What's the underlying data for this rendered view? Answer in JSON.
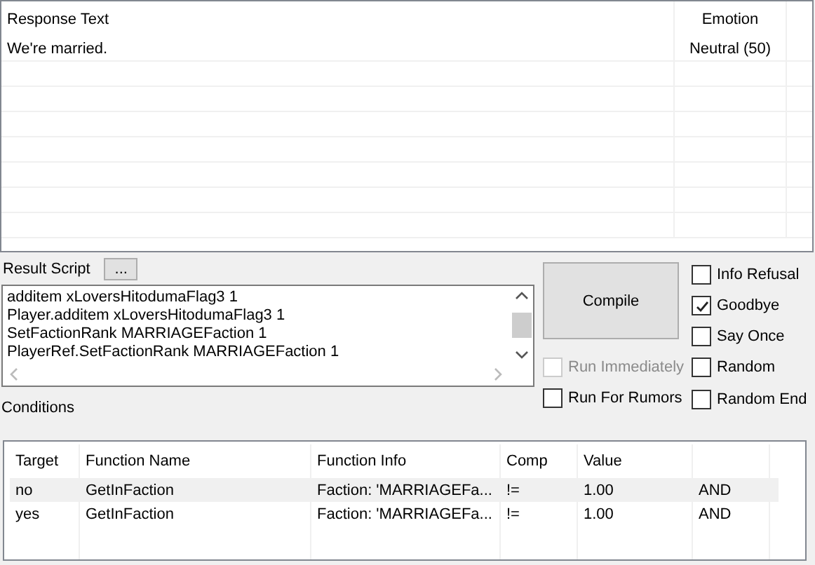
{
  "responses": {
    "columns": [
      "Response Text",
      "Emotion"
    ],
    "rows": [
      {
        "text": "We're married.",
        "emotion": "Neutral (50)"
      }
    ]
  },
  "result_script": {
    "label": "Result Script",
    "browse_button": "...",
    "lines": [
      "additem xLoversHitodumaFlag3 1",
      "Player.additem xLoversHitodumaFlag3 1",
      "SetFactionRank MARRIAGEFaction 1",
      "PlayerRef.SetFactionRank MARRIAGEFaction 1"
    ]
  },
  "compile_button": "Compile",
  "run_options": [
    {
      "label": "Run Immediately",
      "checked": false,
      "disabled": true
    },
    {
      "label": "Run For Rumors",
      "checked": false,
      "disabled": false
    }
  ],
  "flags": [
    {
      "label": "Info Refusal",
      "checked": false
    },
    {
      "label": "Goodbye",
      "checked": true
    },
    {
      "label": "Say Once",
      "checked": false
    },
    {
      "label": "Random",
      "checked": false
    },
    {
      "label": "Random End",
      "checked": false
    }
  ],
  "conditions": {
    "label": "Conditions",
    "columns": [
      "Target",
      "Function Name",
      "Function Info",
      "Comp",
      "Value"
    ],
    "rows": [
      {
        "target": "no",
        "function_name": "GetInFaction",
        "function_info": "Faction: 'MARRIAGEFa...",
        "comp": "!=",
        "value": "1.00",
        "logic": "AND",
        "selected": true
      },
      {
        "target": "yes",
        "function_name": "GetInFaction",
        "function_info": "Faction: 'MARRIAGEFa...",
        "comp": "!=",
        "value": "1.00",
        "logic": "AND",
        "selected": false
      }
    ]
  }
}
